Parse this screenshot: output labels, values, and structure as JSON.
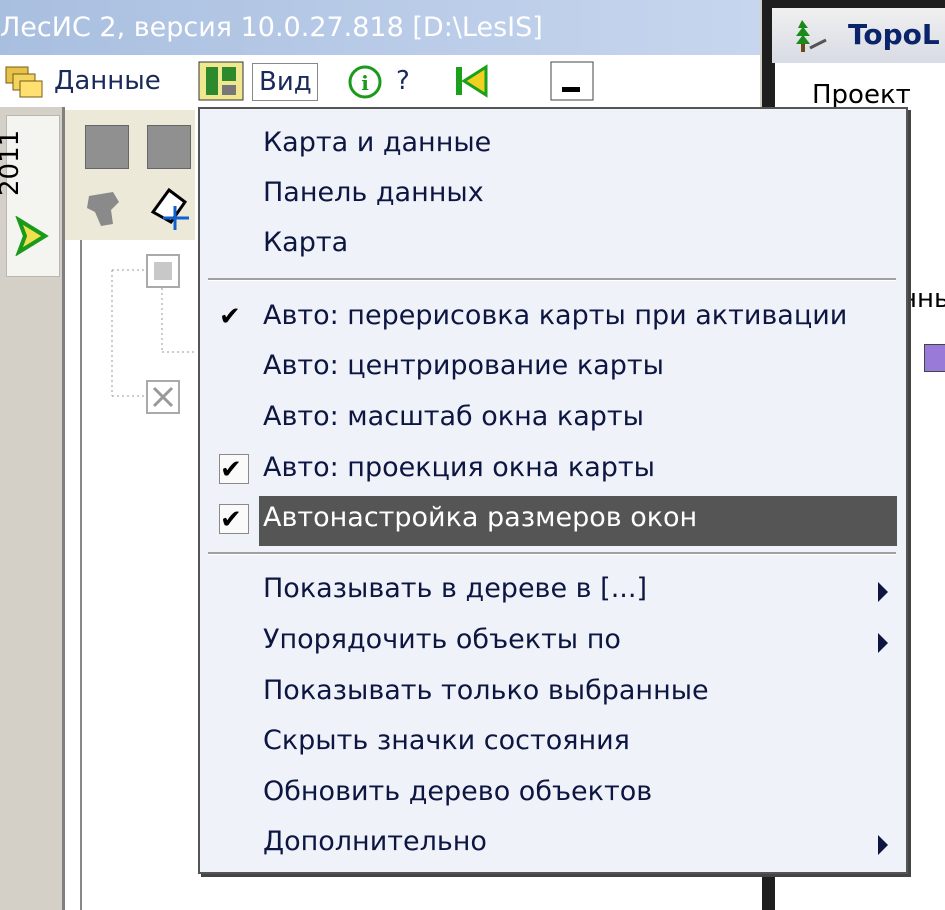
{
  "app": {
    "title": "ЛесИС 2, версия 10.0.27.818  [D:\\LesIS]"
  },
  "menubar": {
    "data_label": "Данные",
    "view_label": "Вид",
    "help_label": "?"
  },
  "left_tab": {
    "year": "2011"
  },
  "right_window": {
    "title": "TopoL",
    "menu_project": "Проект",
    "partial_text": "нны"
  },
  "view_menu": {
    "group1": [
      {
        "label": "Карта и данные"
      },
      {
        "label": "Панель данных"
      },
      {
        "label": "Карта"
      }
    ],
    "group2": [
      {
        "label": "Авто: перерисовка карты при активации",
        "checked": true
      },
      {
        "label": "Авто: центрирование карты",
        "checked": false
      },
      {
        "label": "Авто: масштаб окна карты",
        "checked": false
      },
      {
        "label": "Авто: проекция окна карты",
        "checked": true
      },
      {
        "label": "Автонастройка размеров окон",
        "checked": true,
        "highlighted": true
      }
    ],
    "group3": [
      {
        "label": "Показывать в дереве в [...]",
        "submenu": true
      },
      {
        "label": "Упорядочить объекты по",
        "submenu": true
      },
      {
        "label": "Показывать только выбранные",
        "submenu": false
      },
      {
        "label": "Скрыть значки состояния",
        "submenu": false
      },
      {
        "label": "Обновить дерево объектов",
        "submenu": false
      },
      {
        "label": "Дополнительно",
        "submenu": true
      }
    ],
    "check_glyph": "✔"
  }
}
